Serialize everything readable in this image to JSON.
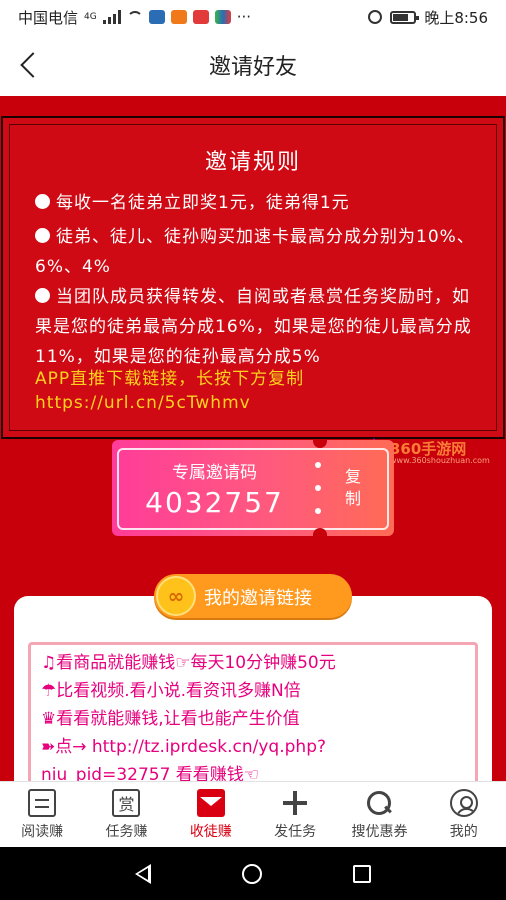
{
  "status_bar": {
    "carrier": "中国电信",
    "network": "4G",
    "more": "···",
    "time": "晚上8:56"
  },
  "header": {
    "title": "邀请好友"
  },
  "rules": {
    "title": "邀请规则",
    "items": [
      "每收一名徒弟立即奖1元，徒弟得1元",
      "徒弟、徒儿、徒孙购买加速卡最高分成分别为10%、6%、4%",
      "当团队成员获得转发、自阅或者悬赏任务奖励时，如果是您的徒弟最高分成16%，如果是您的徒儿最高分成11%，如果是您的徒孙最高分成5%"
    ],
    "download_hint": "APP直推下载链接，长按下方复制",
    "download_url": "https://url.cn/5cTwhmv"
  },
  "invite_code": {
    "label": "专属邀请码",
    "code": "4032757",
    "copy_label": "复制"
  },
  "watermark": {
    "brand": "360手游网",
    "site": "www.360shouzhuan.com"
  },
  "invite_link": {
    "button_label": "我的邀请链接",
    "link_icon": "link-icon",
    "lines": [
      "♫看商品就能赚钱☞每天10分钟赚50元",
      "☂比看视频.看小说.看资讯多赚N倍",
      "♛看看就能赚钱,让看也能产生价值",
      "➽点→  http://tz.iprdesk.cn/yq.php?",
      "niu_pid=32757    看看赚钱☜"
    ]
  },
  "bottom_nav": {
    "items": [
      {
        "label": "阅读赚",
        "icon": "document-icon",
        "active": false
      },
      {
        "label": "任务赚",
        "icon": "reward-icon",
        "active": false
      },
      {
        "label": "收徒赚",
        "icon": "envelope-icon",
        "active": true
      },
      {
        "label": "发任务",
        "icon": "plus-icon",
        "active": false
      },
      {
        "label": "搜优惠券",
        "icon": "search-icon",
        "active": false
      },
      {
        "label": "我的",
        "icon": "user-icon",
        "active": false
      }
    ],
    "reward_glyph": "赏"
  },
  "colors": {
    "primary_red": "#c8000b",
    "active_red": "#d90012",
    "highlight_yellow": "#ffd21f",
    "link_magenta": "#e6007e",
    "button_orange": "#ff9a1e"
  }
}
